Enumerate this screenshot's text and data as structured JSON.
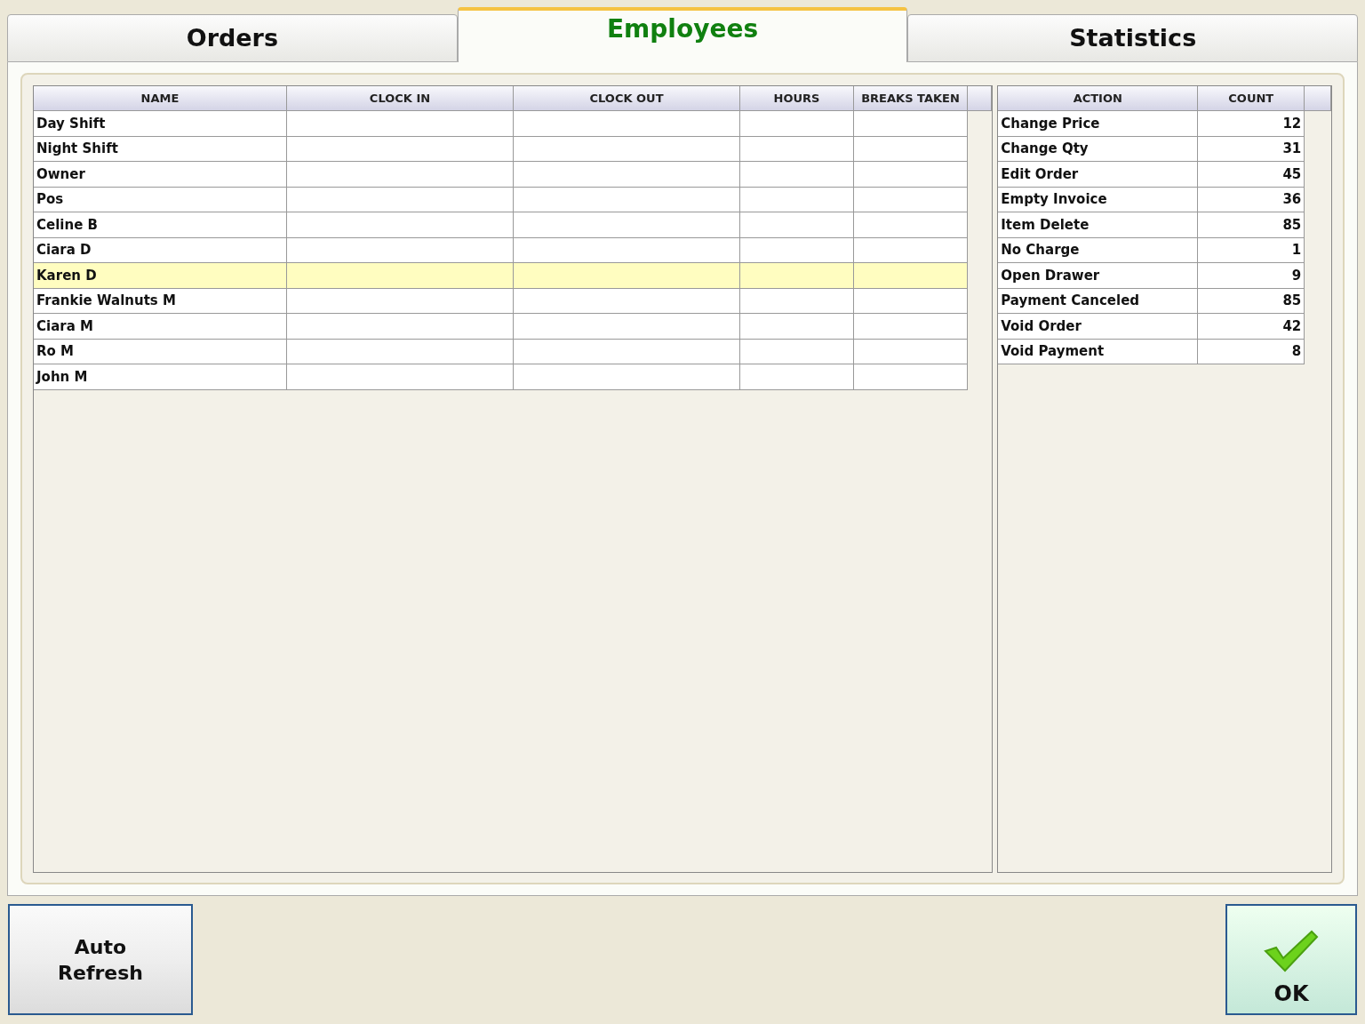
{
  "tabs": [
    {
      "label": "Orders",
      "selected": false
    },
    {
      "label": "Employees",
      "selected": true
    },
    {
      "label": "Statistics",
      "selected": false
    }
  ],
  "employees_table": {
    "columns": [
      "NAME",
      "CLOCK IN",
      "CLOCK OUT",
      "HOURS",
      "BREAKS TAKEN"
    ],
    "rows": [
      {
        "name": "Day Shift",
        "selected": false
      },
      {
        "name": "Night Shift",
        "selected": false
      },
      {
        "name": "Owner",
        "selected": false
      },
      {
        "name": "Pos",
        "selected": false
      },
      {
        "name": "Celine B",
        "selected": false
      },
      {
        "name": "Ciara D",
        "selected": false
      },
      {
        "name": "Karen D",
        "selected": true
      },
      {
        "name": "Frankie Walnuts M",
        "selected": false
      },
      {
        "name": "Ciara M",
        "selected": false
      },
      {
        "name": "Ro M",
        "selected": false
      },
      {
        "name": "John M",
        "selected": false
      }
    ]
  },
  "actions_table": {
    "columns": [
      "ACTION",
      "COUNT"
    ],
    "rows": [
      {
        "action": "Change Price",
        "count": "12"
      },
      {
        "action": "Change Qty",
        "count": "31"
      },
      {
        "action": "Edit Order",
        "count": "45"
      },
      {
        "action": "Empty Invoice",
        "count": "36"
      },
      {
        "action": "Item Delete",
        "count": "85"
      },
      {
        "action": "No Charge",
        "count": "1"
      },
      {
        "action": "Open Drawer",
        "count": "9"
      },
      {
        "action": "Payment Canceled",
        "count": "85"
      },
      {
        "action": "Void Order",
        "count": "42"
      },
      {
        "action": "Void Payment",
        "count": "8"
      }
    ]
  },
  "buttons": {
    "auto_refresh": [
      "Auto",
      "Refresh"
    ],
    "ok": "OK"
  }
}
